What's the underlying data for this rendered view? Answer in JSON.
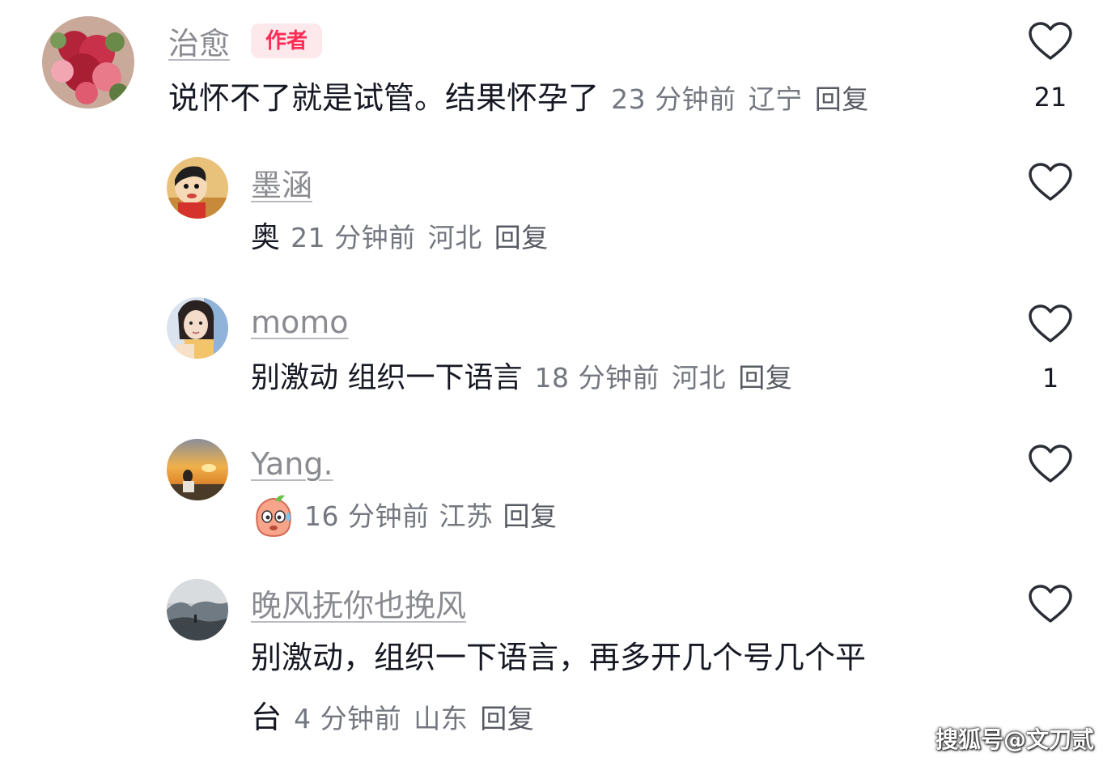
{
  "comments": [
    {
      "username": "治愈",
      "badge": "作者",
      "text": "说怀不了就是试管。结果怀孕了",
      "time": "23 分钟前",
      "location": "辽宁",
      "reply_label": "回复",
      "likes": "21",
      "avatar": "flower-bouquet-avatar"
    },
    {
      "username": "墨涵",
      "text": "奥",
      "time": "21 分钟前",
      "location": "河北",
      "reply_label": "回复",
      "likes": "",
      "avatar": "cartoon-boy-avatar"
    },
    {
      "username": "momo",
      "text": "别激动 组织一下语言",
      "time": "18 分钟前",
      "location": "河北",
      "reply_label": "回复",
      "likes": "1",
      "avatar": "girl-portrait-avatar"
    },
    {
      "username": "Yang.",
      "text": "",
      "emoji": "sweating-face-emoji",
      "time": "16 分钟前",
      "location": "江苏",
      "reply_label": "回复",
      "likes": "",
      "avatar": "sunset-avatar"
    },
    {
      "username": "晚风抚你也挽风",
      "text_line1": "别激动，组织一下语言，再多开几个号几个平",
      "text_line2": "台",
      "time": "4 分钟前",
      "location": "山东",
      "reply_label": "回复",
      "likes": "",
      "avatar": "misty-landscape-avatar"
    }
  ],
  "watermark": "搜狐号@文刀贰",
  "colors": {
    "accent": "#fe2c55",
    "badge_bg": "#fde8ec",
    "username": "#8a8b91",
    "meta": "#747780",
    "text": "#161823"
  },
  "icons": {
    "like": "heart-outline-icon"
  }
}
